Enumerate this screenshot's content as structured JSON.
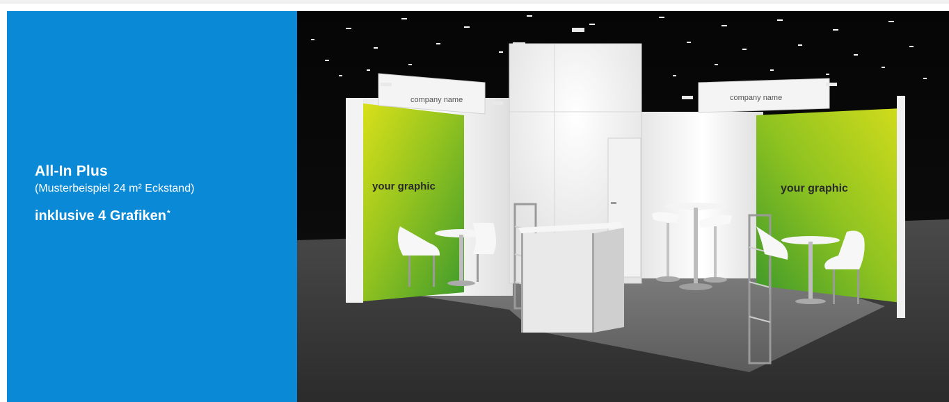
{
  "info": {
    "title": "All-In Plus",
    "subtitle": "(Musterbeispiel 24 m²  Eckstand)",
    "feature": "inklusive 4 Grafiken",
    "feature_mark": "*"
  },
  "scene": {
    "sign_left": "company name",
    "sign_right": "company name",
    "graphic_left": "your graphic",
    "graphic_right": "your graphic"
  },
  "colors": {
    "panel_blue": "#0a8ad6",
    "graphic_green": "#8cc11e",
    "hall_black": "#0b0b0b"
  }
}
